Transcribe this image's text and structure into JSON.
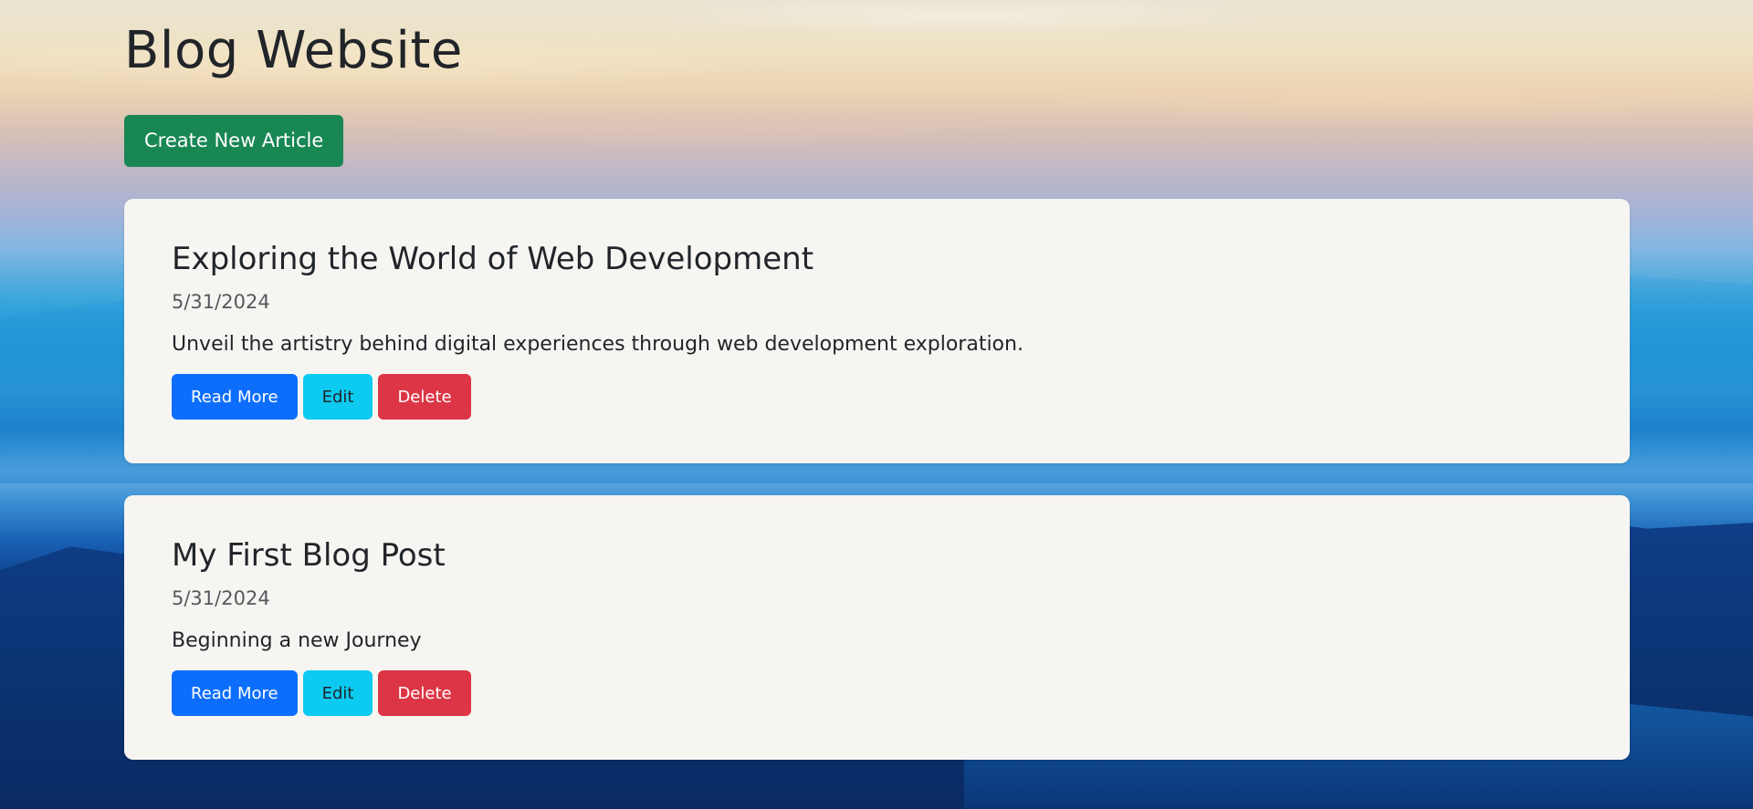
{
  "header": {
    "title": "Blog Website",
    "create_label": "Create New Article"
  },
  "articles": [
    {
      "title": "Exploring the World of Web Development",
      "date": "5/31/2024",
      "summary": "Unveil the artistry behind digital experiences through web development exploration.",
      "read_more_label": "Read More",
      "edit_label": "Edit",
      "delete_label": "Delete"
    },
    {
      "title": "My First Blog Post",
      "date": "5/31/2024",
      "summary": "Beginning a new Journey",
      "read_more_label": "Read More",
      "edit_label": "Edit",
      "delete_label": "Delete"
    }
  ],
  "colors": {
    "success": "#198754",
    "primary": "#0d6efd",
    "info": "#0dcaf0",
    "danger": "#dc3545",
    "card_bg": "#f6f5f2"
  }
}
